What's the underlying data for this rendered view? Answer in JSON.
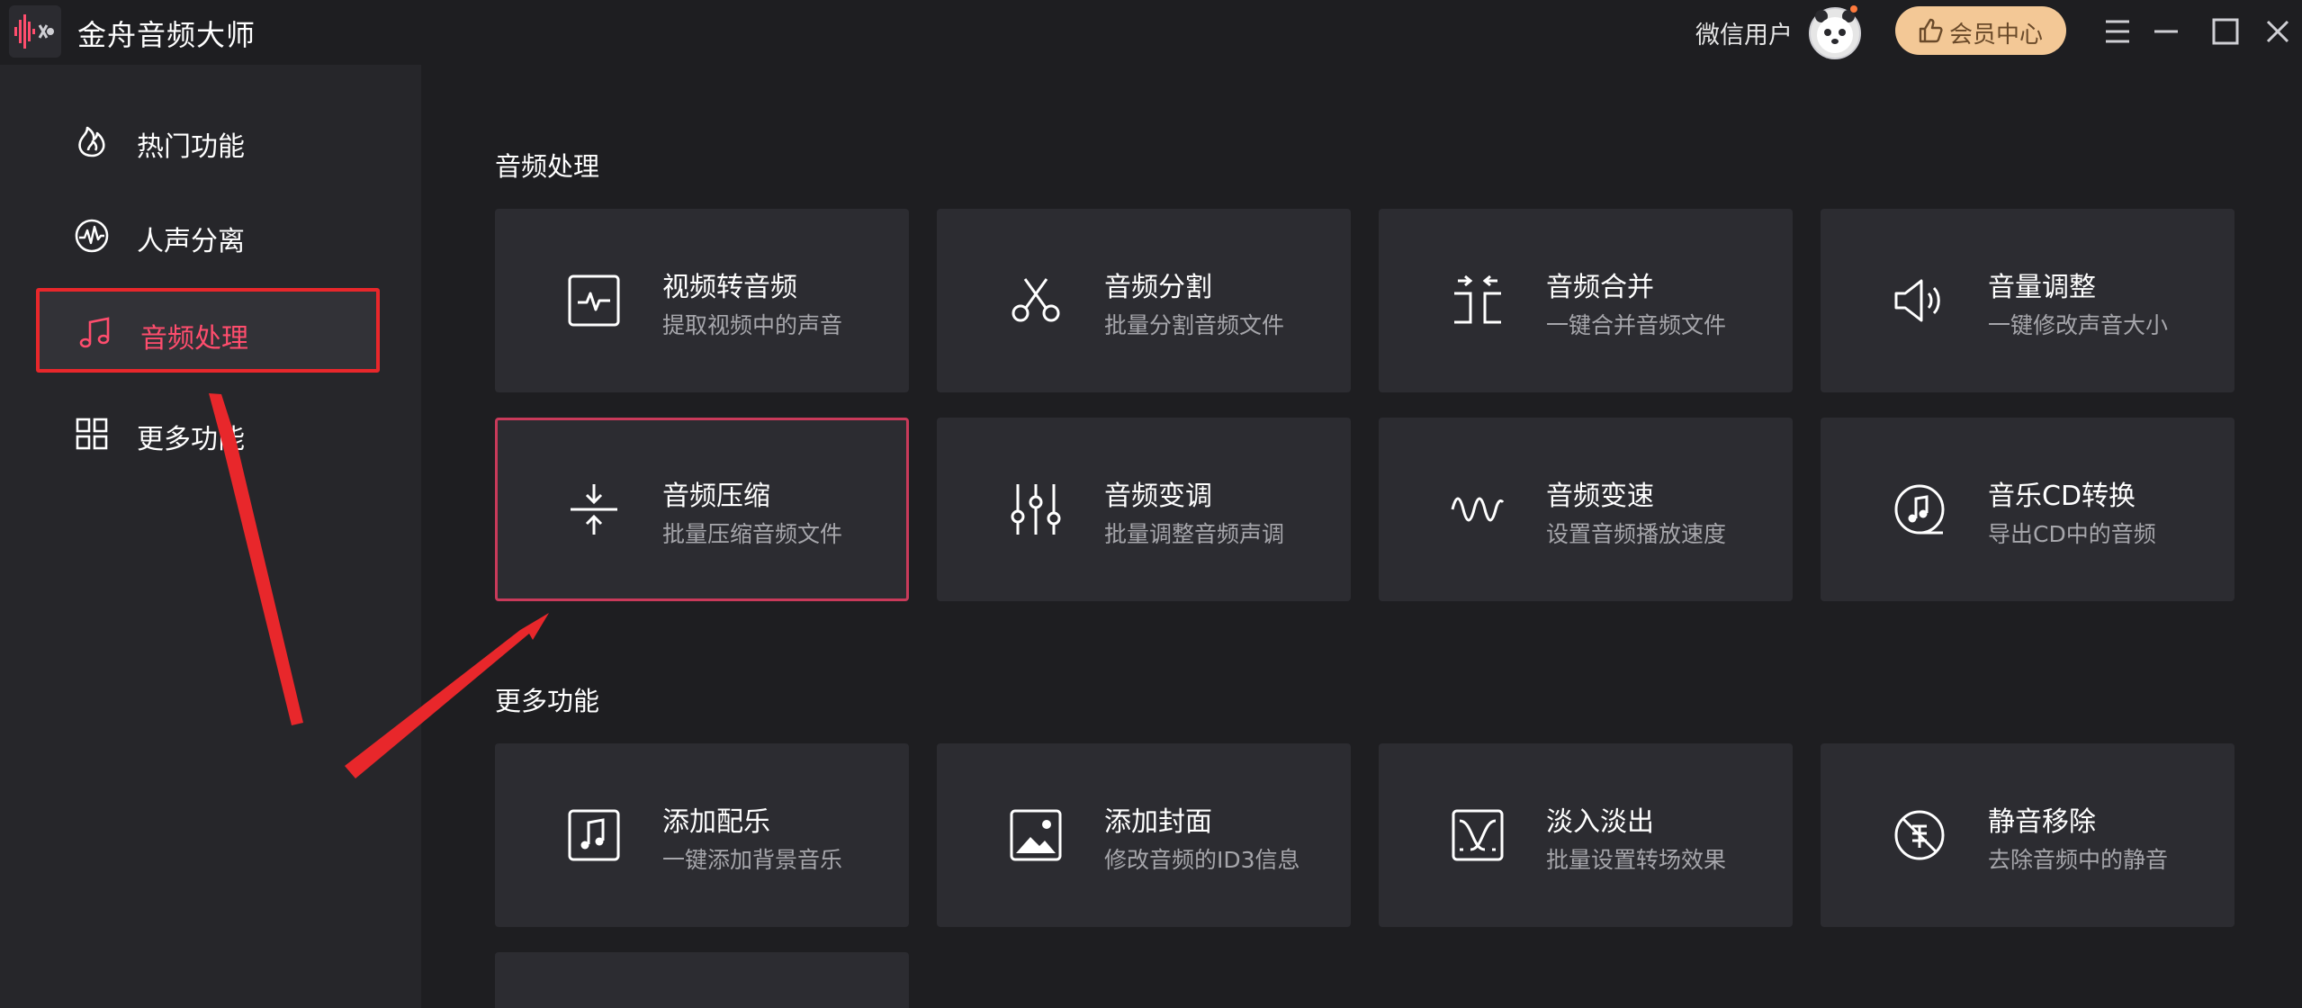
{
  "app": {
    "title": "金舟音频大师"
  },
  "header": {
    "user_name": "微信用户",
    "vip_label": "会员中心"
  },
  "sidebar": {
    "items": [
      {
        "label": "热门功能",
        "icon": "flame-icon"
      },
      {
        "label": "人声分离",
        "icon": "waveform-circle-icon"
      },
      {
        "label": "音频处理",
        "icon": "music-note-icon",
        "active": true
      },
      {
        "label": "更多功能",
        "icon": "grid-icon"
      }
    ]
  },
  "main": {
    "sections": [
      {
        "title": "音频处理",
        "cards": [
          {
            "title": "视频转音频",
            "subtitle": "提取视频中的声音",
            "icon": "pulse-box-icon"
          },
          {
            "title": "音频分割",
            "subtitle": "批量分割音频文件",
            "icon": "scissors-icon"
          },
          {
            "title": "音频合并",
            "subtitle": "一键合并音频文件",
            "icon": "merge-icon"
          },
          {
            "title": "音量调整",
            "subtitle": "一键修改声音大小",
            "icon": "speaker-icon"
          },
          {
            "title": "音频压缩",
            "subtitle": "批量压缩音频文件",
            "icon": "compress-icon",
            "highlighted": true
          },
          {
            "title": "音频变调",
            "subtitle": "批量调整音频声调",
            "icon": "equalizer-icon"
          },
          {
            "title": "音频变速",
            "subtitle": "设置音频播放速度",
            "icon": "sine-wave-icon"
          },
          {
            "title": "音乐CD转换",
            "subtitle": "导出CD中的音频",
            "icon": "cd-music-icon"
          }
        ]
      },
      {
        "title": "更多功能",
        "cards": [
          {
            "title": "添加配乐",
            "subtitle": "一键添加背景音乐",
            "icon": "music-box-icon"
          },
          {
            "title": "添加封面",
            "subtitle": "修改音频的ID3信息",
            "icon": "image-box-icon"
          },
          {
            "title": "淡入淡出",
            "subtitle": "批量设置转场效果",
            "icon": "fade-box-icon"
          },
          {
            "title": "静音移除",
            "subtitle": "去除音频中的静音",
            "icon": "mute-remove-icon"
          }
        ]
      }
    ]
  },
  "colors": {
    "background": "#1e1e21",
    "sidebar": "#26262a",
    "card": "#2c2c31",
    "accent": "#ff4d6d",
    "annotation_red": "#e8272b",
    "vip_gold": "#f3c896"
  }
}
